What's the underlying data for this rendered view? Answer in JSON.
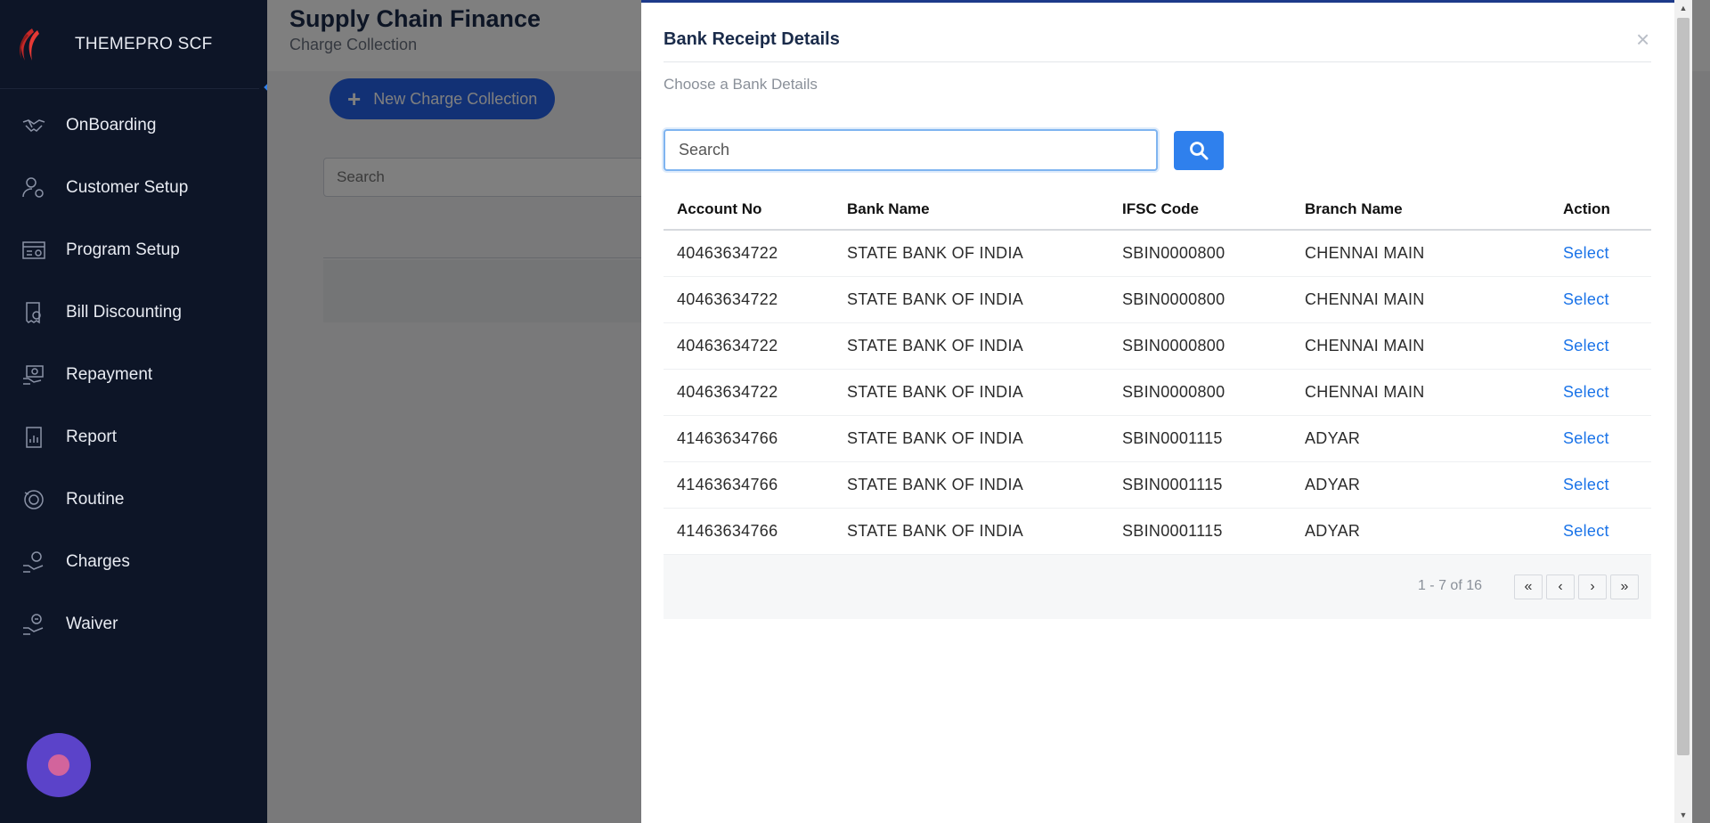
{
  "sidebar": {
    "brand": "THEMEPRO SCF",
    "items": [
      {
        "label": "OnBoarding",
        "icon": "handshake-icon"
      },
      {
        "label": "Customer Setup",
        "icon": "user-gear-icon"
      },
      {
        "label": "Program Setup",
        "icon": "program-icon"
      },
      {
        "label": "Bill Discounting",
        "icon": "bill-discount-icon"
      },
      {
        "label": "Repayment",
        "icon": "repayment-icon"
      },
      {
        "label": "Report",
        "icon": "report-icon"
      },
      {
        "label": "Routine",
        "icon": "routine-icon"
      },
      {
        "label": "Charges",
        "icon": "charges-icon"
      },
      {
        "label": "Waiver",
        "icon": "waiver-icon"
      }
    ]
  },
  "page": {
    "title": "Supply Chain Finance",
    "subtitle": "Charge Collection",
    "new_button": "New Charge Collection",
    "search_placeholder": "Search"
  },
  "modal": {
    "title": "Bank Receipt Details",
    "subtitle": "Choose a Bank Details",
    "close": "×",
    "search_placeholder": "Search",
    "columns": [
      "Account No",
      "Bank Name",
      "IFSC Code",
      "Branch Name",
      "Action"
    ],
    "rows": [
      {
        "account": "40463634722",
        "bank": "STATE BANK OF INDIA",
        "ifsc": "SBIN0000800",
        "branch": "CHENNAI MAIN",
        "action": "Select"
      },
      {
        "account": "40463634722",
        "bank": "STATE BANK OF INDIA",
        "ifsc": "SBIN0000800",
        "branch": "CHENNAI MAIN",
        "action": "Select"
      },
      {
        "account": "40463634722",
        "bank": "STATE BANK OF INDIA",
        "ifsc": "SBIN0000800",
        "branch": "CHENNAI MAIN",
        "action": "Select"
      },
      {
        "account": "40463634722",
        "bank": "STATE BANK OF INDIA",
        "ifsc": "SBIN0000800",
        "branch": "CHENNAI MAIN",
        "action": "Select"
      },
      {
        "account": "41463634766",
        "bank": "STATE BANK OF INDIA",
        "ifsc": "SBIN0001115",
        "branch": "ADYAR",
        "action": "Select"
      },
      {
        "account": "41463634766",
        "bank": "STATE BANK OF INDIA",
        "ifsc": "SBIN0001115",
        "branch": "ADYAR",
        "action": "Select"
      },
      {
        "account": "41463634766",
        "bank": "STATE BANK OF INDIA",
        "ifsc": "SBIN0001115",
        "branch": "ADYAR",
        "action": "Select"
      }
    ],
    "pagination": {
      "info": "1 - 7 of 16",
      "first": "«",
      "prev": "‹",
      "next": "›",
      "last": "»"
    }
  },
  "colors": {
    "sidebar_bg": "#0d1527",
    "primary": "#2563eb",
    "link": "#1a73e8",
    "fab": "#5b43c9"
  }
}
